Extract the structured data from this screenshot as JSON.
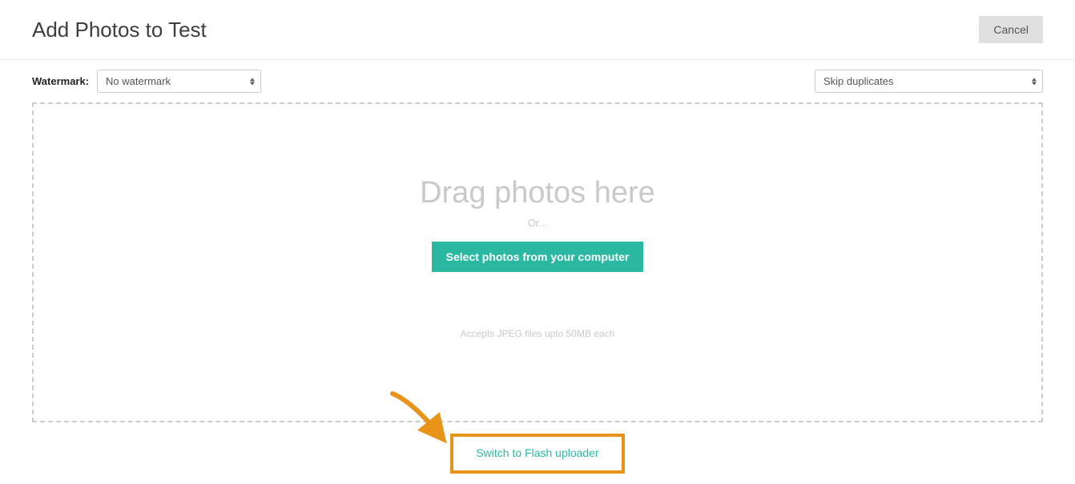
{
  "header": {
    "title": "Add Photos to Test",
    "cancel_label": "Cancel"
  },
  "controls": {
    "watermark_label": "Watermark:",
    "watermark_selected": "No watermark",
    "duplicates_selected": "Skip duplicates"
  },
  "dropzone": {
    "drag_text": "Drag photos here",
    "or_text": "Or...",
    "select_button_label": "Select photos from your computer",
    "accepts_text": "Accepts JPEG files upto 50MB each"
  },
  "footer": {
    "switch_link_label": "Switch to Flash uploader"
  }
}
